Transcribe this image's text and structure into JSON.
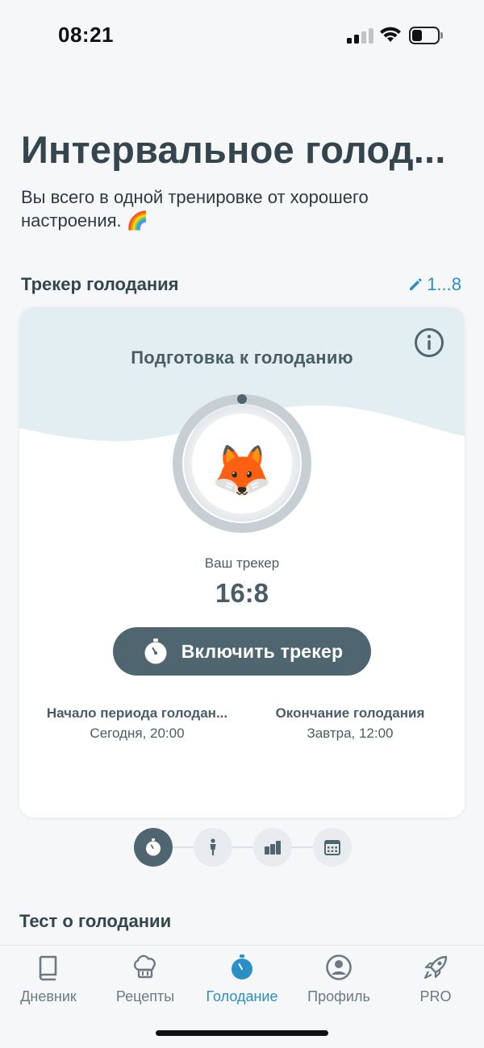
{
  "status_bar": {
    "time": "08:21"
  },
  "header": {
    "title": "Интервальное голод...",
    "subtitle": "Вы всего в одной тренировке от хорошего настроения. 🌈"
  },
  "tracker_section": {
    "title": "Трекер голодания",
    "edit_label": "1...8"
  },
  "tracker_card": {
    "heading": "Подготовка к голоданию",
    "avatar_emoji": "🦊",
    "tracker_label": "Ваш трекер",
    "tracker_value": "16:8",
    "start_button_label": "Включить трекер",
    "period_start": {
      "title": "Начало периода голодан...",
      "value": "Сегодня, 20:00"
    },
    "period_end": {
      "title": "Окончание голодания",
      "value": "Завтра, 12:00"
    }
  },
  "pager": {
    "items": [
      "stopwatch-icon",
      "person-icon",
      "bar-chart-icon",
      "calendar-icon"
    ],
    "active_index": 0
  },
  "quiz_section": {
    "title": "Тест о голодании"
  },
  "tab_bar": {
    "tabs": [
      {
        "label": "Дневник",
        "icon": "book-icon"
      },
      {
        "label": "Рецепты",
        "icon": "chef-hat-icon"
      },
      {
        "label": "Голодание",
        "icon": "stopwatch-icon"
      },
      {
        "label": "Профиль",
        "icon": "profile-icon"
      },
      {
        "label": "PRO",
        "icon": "rocket-icon"
      }
    ],
    "active_index": 2
  },
  "colors": {
    "accent": "#2a8fc7",
    "primary_dark": "#4f6670",
    "text_dark": "#34454d",
    "wave_bg": "#e3eef3"
  }
}
